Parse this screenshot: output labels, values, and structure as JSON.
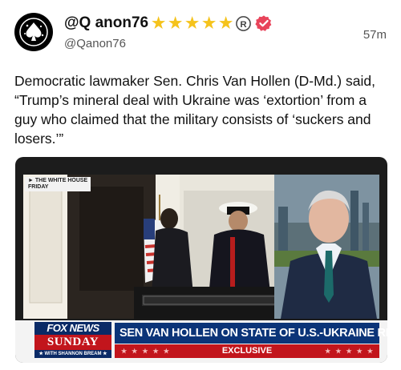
{
  "author": {
    "display_name": "@Q anon76",
    "handle": "@Qanon76",
    "badges": [
      "star-icon",
      "star-icon",
      "star-icon",
      "star-icon",
      "star-icon",
      "registered-icon",
      "verified-badge-icon"
    ],
    "accent_color": "#e8445a",
    "star_color": "#f5c31c"
  },
  "post": {
    "timestamp": "57m",
    "text": "Democratic lawmaker Sen. Chris Van Hollen (D-Md.) said, “Trump’s mineral deal with Ukraine was ‘extortion’ from a guy who claimed that the military consists of ‘suckers and losers.’”"
  },
  "media": {
    "location_tag_line1": "THE WHITE HOUSE",
    "location_tag_line2": "FRIDAY",
    "network": "FOX NEWS",
    "program": "SUNDAY",
    "host": "WITH SHANNON BREAM",
    "headline": "SEN VAN HOLLEN ON STATE OF U.S.-UKRAINE RELATIONS",
    "banner": "EXCLUSIVE"
  }
}
